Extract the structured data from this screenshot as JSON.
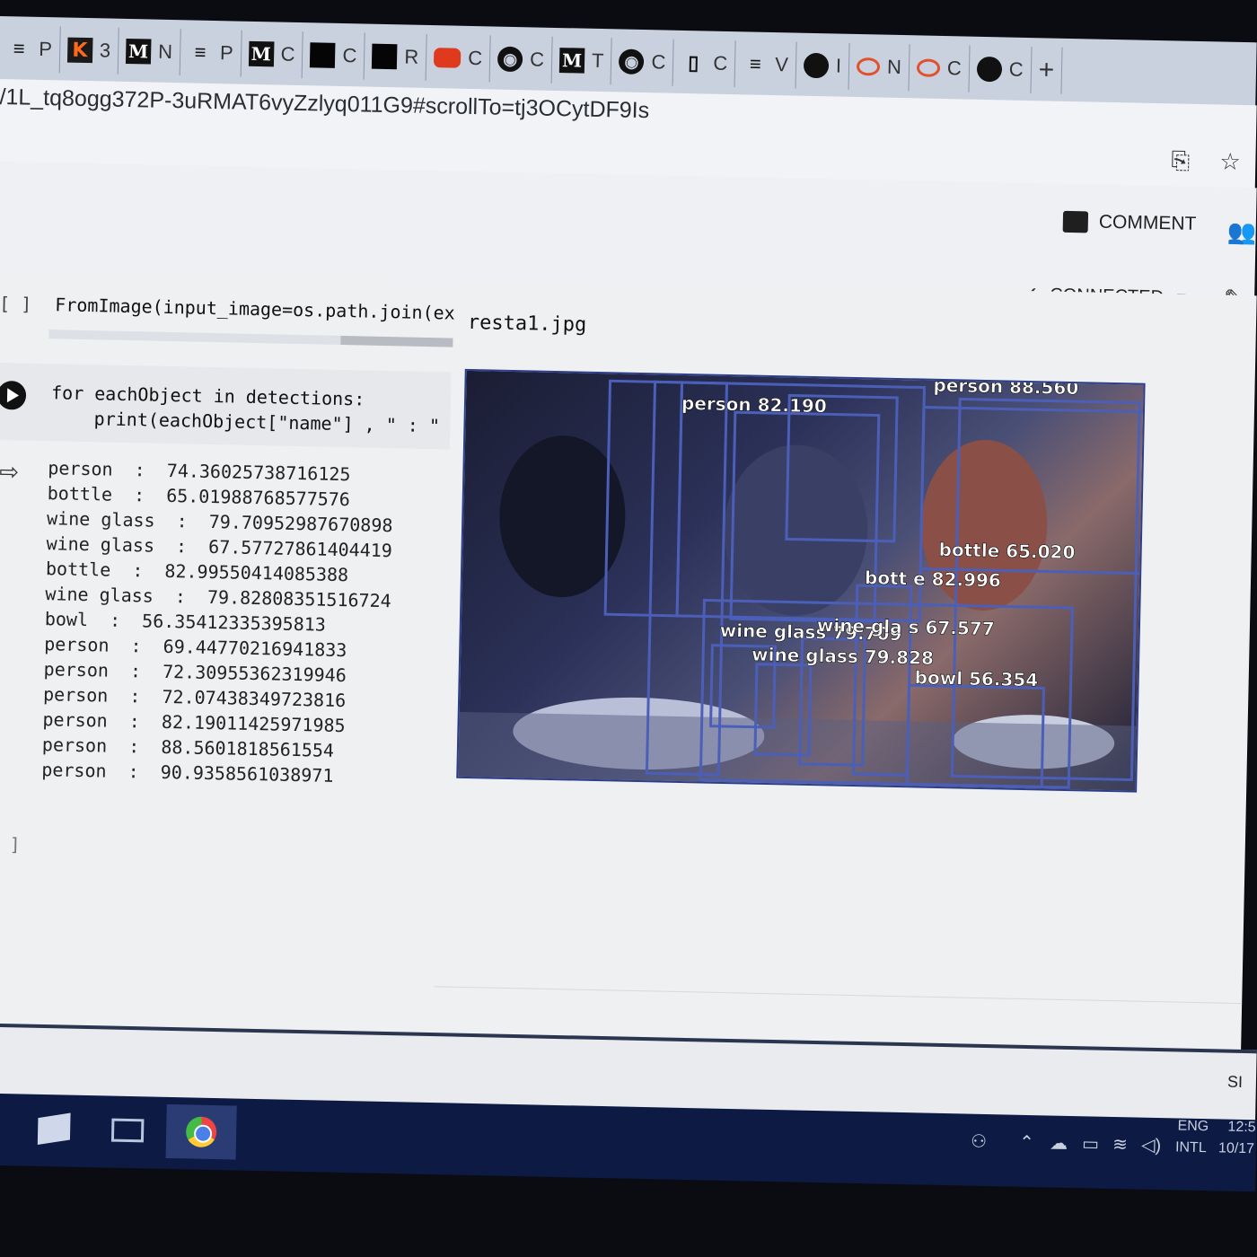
{
  "tabs": [
    {
      "icon": "stackoverflow-icon",
      "label": "P"
    },
    {
      "icon": "k-icon",
      "glyph": "K",
      "label": "3"
    },
    {
      "icon": "medium-icon",
      "glyph": "M",
      "label": "N"
    },
    {
      "icon": "stackoverflow-icon",
      "label": "P"
    },
    {
      "icon": "m-script-icon",
      "glyph": "M",
      "label": "C"
    },
    {
      "icon": "black-square-icon",
      "label": "C"
    },
    {
      "icon": "black-square-icon",
      "label": "R"
    },
    {
      "icon": "youtube-icon",
      "label": "C"
    },
    {
      "icon": "github-icon",
      "label": "C"
    },
    {
      "icon": "medium-icon",
      "glyph": "M",
      "label": "T"
    },
    {
      "icon": "github-icon",
      "label": "C"
    },
    {
      "icon": "document-icon",
      "label": "C"
    },
    {
      "icon": "stackoverflow-icon",
      "label": "V"
    },
    {
      "icon": "shield-icon",
      "label": "I"
    },
    {
      "icon": "colab-icon",
      "label": "N"
    },
    {
      "icon": "colab-icon",
      "label": "C"
    },
    {
      "icon": "circle-icon",
      "label": "C"
    }
  ],
  "new_tab_label": "+",
  "url": "/1L_tq8ogg372P-3uRMAT6vyZzlyq011G9#scrollTo=tj3OCytDF9Is",
  "header": {
    "comment_label": "COMMENT",
    "connected_label": "CONNECTED"
  },
  "cell1": {
    "bracket": "[ ]",
    "code": "FromImage(input_image=os.path.join(ex"
  },
  "cell2": {
    "code": "for eachObject in detections:\n    print(eachObject[\"name\"] , \" : \""
  },
  "output": {
    "lines": [
      "person  :  74.36025738716125",
      "bottle  :  65.01988768577576",
      "wine glass  :  79.70952987670898",
      "wine glass  :  67.57727861404419",
      "bottle  :  82.99550414085388",
      "wine glass  :  79.82808351516724",
      "bowl  :  56.35412335395813",
      "person  :  69.44770216941833",
      "person  :  72.30955362319946",
      "person  :  72.07438349723816",
      "person  :  82.19011425971985",
      "person  :  88.5601818561554",
      "person  :  90.9358561038971"
    ]
  },
  "image": {
    "title": "resta1.jpg",
    "labels": [
      "person 82.190",
      "person 88.560",
      "bottle 65.020",
      "bott e 82.996",
      "wine glass 79.709",
      "wine gla s 67.577",
      "wine glass 79.828",
      "bowl 56.354"
    ]
  },
  "cell3": {
    "bracket": "[ ]"
  },
  "statusbar": {
    "button": "SI"
  },
  "taskbar": {
    "lang": "ENG",
    "layout": "INTL",
    "time": "12:5",
    "date": "10/17"
  },
  "colors": {
    "box": "#4c5fb8",
    "accent": "#1a73e8"
  }
}
